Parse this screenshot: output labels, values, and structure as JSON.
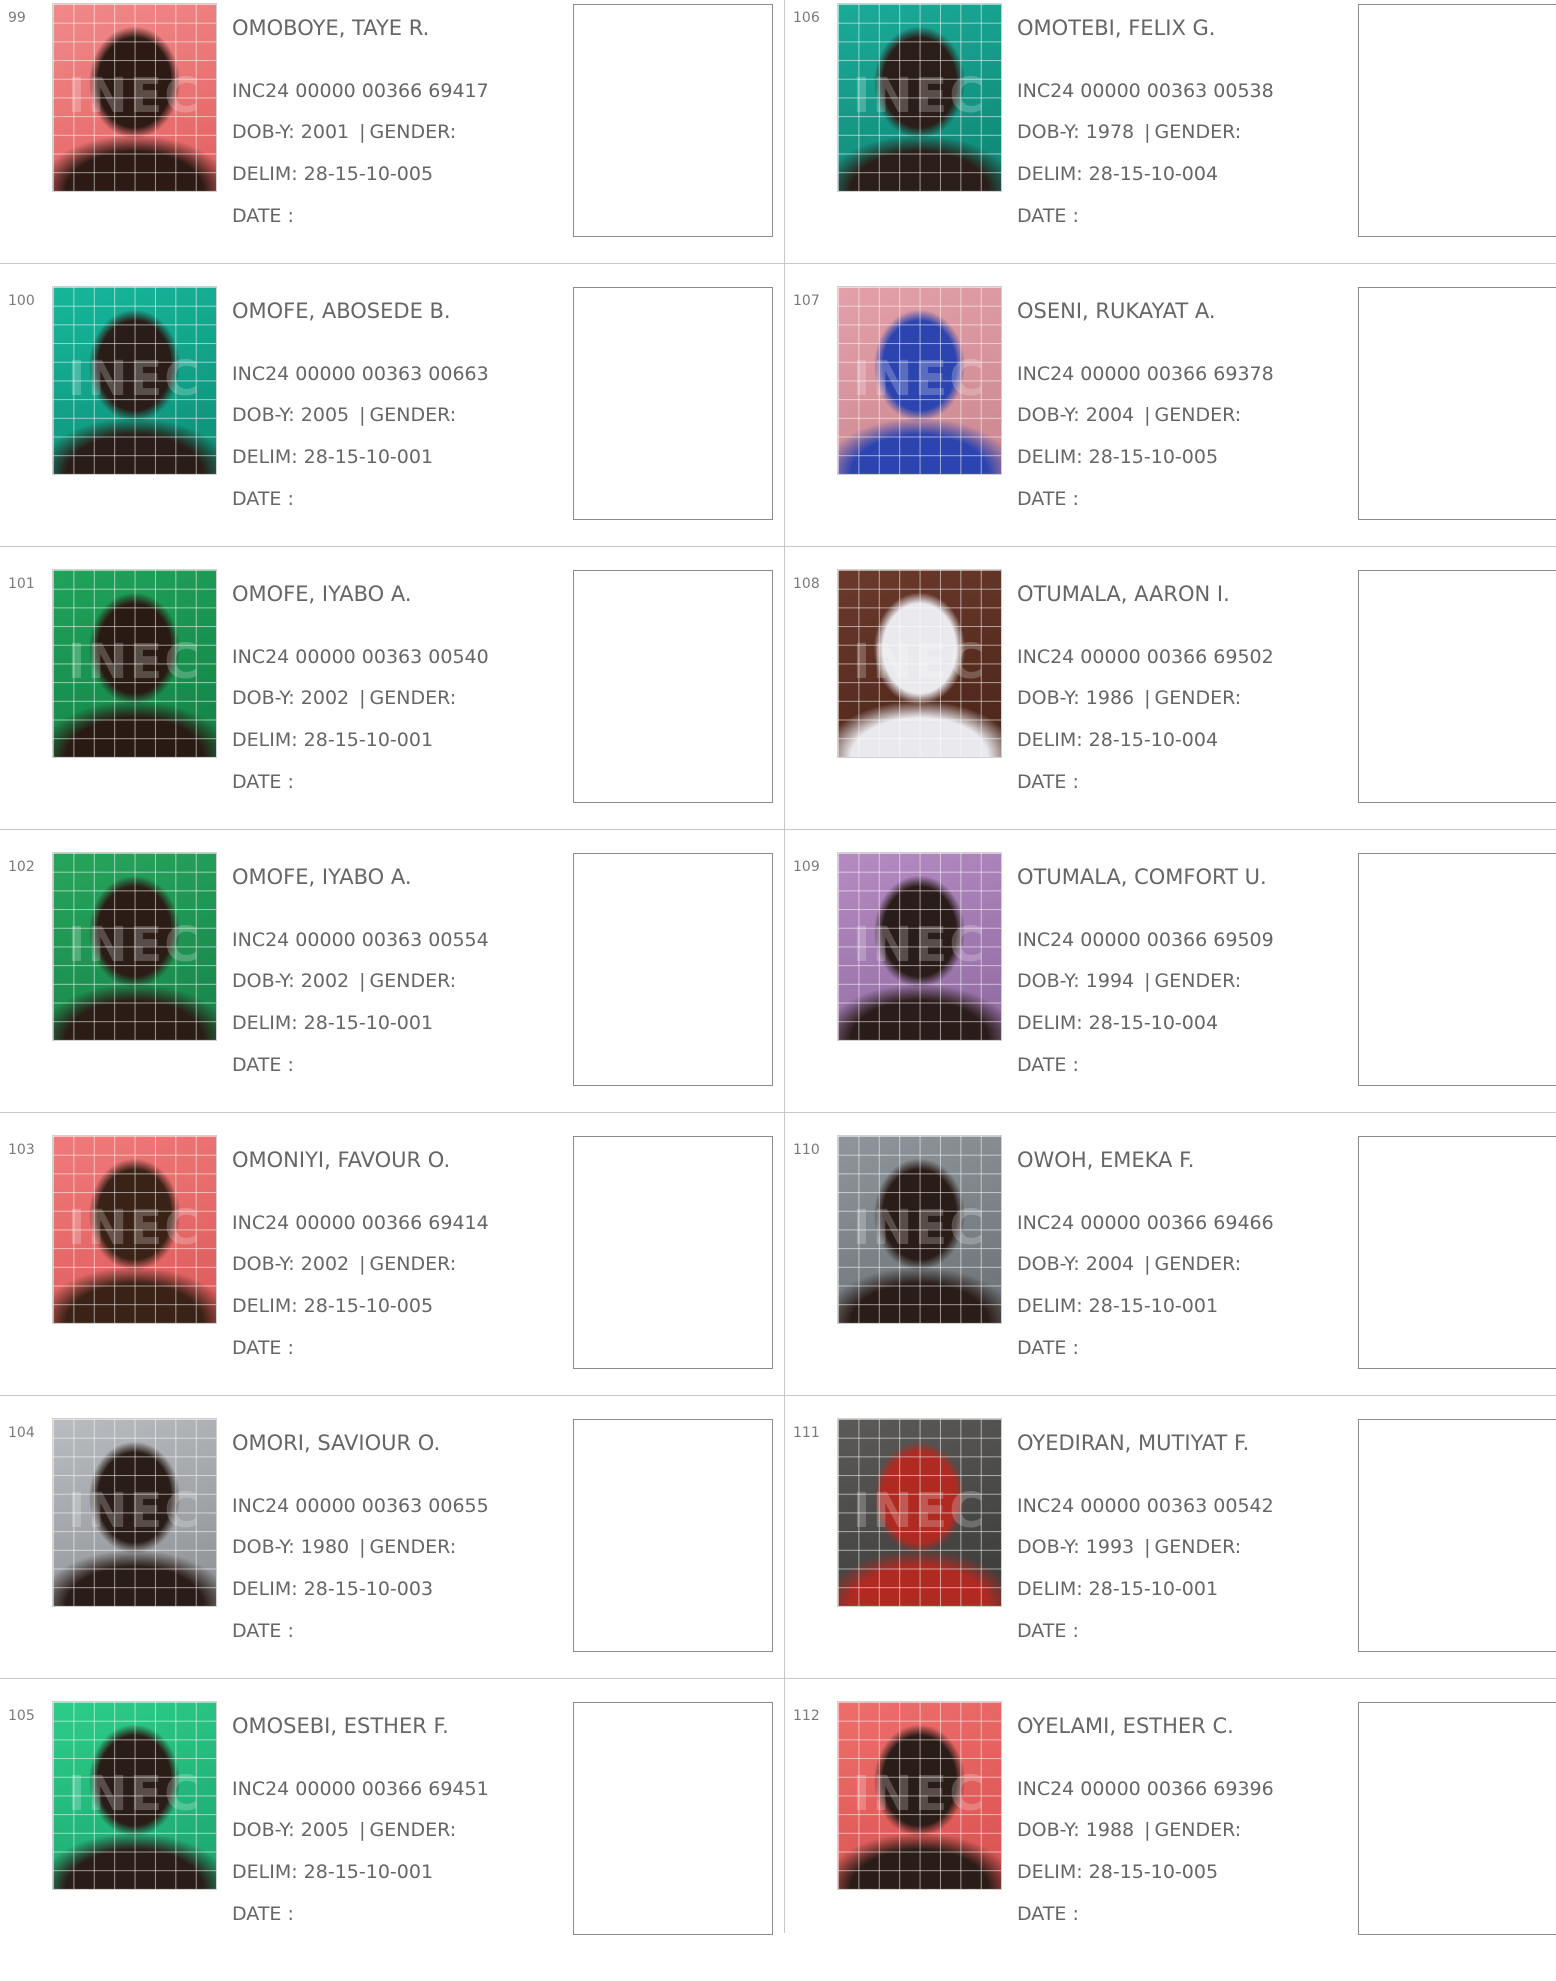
{
  "columns": [
    {
      "records": [
        {
          "number": "99",
          "name": "OMOBOYE, TAYE R.",
          "vin": "INC24 00000 00366 69417",
          "dob_label": "DOB-Y:",
          "dob": "2001",
          "gender_label": "GENDER:",
          "delim_label": "DELIM:",
          "delim": "28-15-10-005",
          "date_label": "DATE :",
          "photo_colors": [
            "#f08a8a",
            "#e45f5f",
            "#2d1a14"
          ]
        },
        {
          "number": "100",
          "name": "OMOFE, ABOSEDE B.",
          "vin": "INC24 00000 00363 00663",
          "dob_label": "DOB-Y:",
          "dob": "2005",
          "gender_label": "GENDER:",
          "delim_label": "DELIM:",
          "delim": "28-15-10-001",
          "date_label": "DATE :",
          "photo_colors": [
            "#16b79c",
            "#0d8e76",
            "#2a1d18"
          ]
        },
        {
          "number": "101",
          "name": "OMOFE, IYABO A.",
          "vin": "INC24 00000 00363 00540",
          "dob_label": "DOB-Y:",
          "dob": "2002",
          "gender_label": "GENDER:",
          "delim_label": "DELIM:",
          "delim": "28-15-10-001",
          "date_label": "DATE :",
          "photo_colors": [
            "#1fa35a",
            "#138245",
            "#2a1a14"
          ]
        },
        {
          "number": "102",
          "name": "OMOFE, IYABO A.",
          "vin": "INC24 00000 00363 00554",
          "dob_label": "DOB-Y:",
          "dob": "2002",
          "gender_label": "GENDER:",
          "delim_label": "DELIM:",
          "delim": "28-15-10-001",
          "date_label": "DATE :",
          "photo_colors": [
            "#26a55c",
            "#178448",
            "#2b1c16"
          ]
        },
        {
          "number": "103",
          "name": "OMONIYI, FAVOUR O.",
          "vin": "INC24 00000 00366 69414",
          "dob_label": "DOB-Y:",
          "dob": "2002",
          "gender_label": "GENDER:",
          "delim_label": "DELIM:",
          "delim": "28-15-10-005",
          "date_label": "DATE :",
          "photo_colors": [
            "#f07a7a",
            "#dd5959",
            "#3a2216"
          ]
        },
        {
          "number": "104",
          "name": "OMORI, SAVIOUR O.",
          "vin": "INC24 00000 00363 00655",
          "dob_label": "DOB-Y:",
          "dob": "1980",
          "gender_label": "GENDER:",
          "delim_label": "DELIM:",
          "delim": "28-15-10-003",
          "date_label": "DATE :",
          "photo_colors": [
            "#b9bcc0",
            "#8c8f93",
            "#2a1c17"
          ]
        },
        {
          "number": "105",
          "name": "OMOSEBI, ESTHER F.",
          "vin": "INC24 00000 00366 69451",
          "dob_label": "DOB-Y:",
          "dob": "2005",
          "gender_label": "GENDER:",
          "delim_label": "DELIM:",
          "delim": "28-15-10-001",
          "date_label": "DATE :",
          "photo_colors": [
            "#2ccd8a",
            "#1ba56e",
            "#2a1c16"
          ]
        }
      ]
    },
    {
      "records": [
        {
          "number": "106",
          "name": "OMOTEBI, FELIX G.",
          "vin": "INC24 00000 00363 00538",
          "dob_label": "DOB-Y:",
          "dob": "1978",
          "gender_label": "GENDER:",
          "delim_label": "DELIM:",
          "delim": "28-15-10-004",
          "date_label": "DATE :",
          "photo_colors": [
            "#1bab99",
            "#0f8574",
            "#2b1d18"
          ]
        },
        {
          "number": "107",
          "name": "OSENI, RUKAYAT A.",
          "vin": "INC24 00000 00366 69378",
          "dob_label": "DOB-Y:",
          "dob": "2004",
          "gender_label": "GENDER:",
          "delim_label": "DELIM:",
          "delim": "28-15-10-005",
          "date_label": "DATE :",
          "photo_colors": [
            "#e4a0a8",
            "#c98790",
            "#2c44b0"
          ]
        },
        {
          "number": "108",
          "name": "OTUMALA, AARON I.",
          "vin": "INC24 00000 00366 69502",
          "dob_label": "DOB-Y:",
          "dob": "1986",
          "gender_label": "GENDER:",
          "delim_label": "DELIM:",
          "delim": "28-15-10-004",
          "date_label": "DATE :",
          "photo_colors": [
            "#6b3a2c",
            "#4a2418",
            "#e9e9ee"
          ]
        },
        {
          "number": "109",
          "name": "OTUMALA, COMFORT U.",
          "vin": "INC24 00000 00366 69509",
          "dob_label": "DOB-Y:",
          "dob": "1994",
          "gender_label": "GENDER:",
          "delim_label": "DELIM:",
          "delim": "28-15-10-004",
          "date_label": "DATE :",
          "photo_colors": [
            "#b58bc2",
            "#8e6aa0",
            "#2a1c18"
          ]
        },
        {
          "number": "110",
          "name": "OWOH, EMEKA F.",
          "vin": "INC24 00000 00366 69466",
          "dob_label": "DOB-Y:",
          "dob": "2004",
          "gender_label": "GENDER:",
          "delim_label": "DELIM:",
          "delim": "28-15-10-001",
          "date_label": "DATE :",
          "photo_colors": [
            "#8e969b",
            "#6a7176",
            "#2a1c17"
          ]
        },
        {
          "number": "111",
          "name": "OYEDIRAN, MUTIYAT F.",
          "vin": "INC24 00000 00363 00542",
          "dob_label": "DOB-Y:",
          "dob": "1993",
          "gender_label": "GENDER:",
          "delim_label": "DELIM:",
          "delim": "28-15-10-001",
          "date_label": "DATE :",
          "photo_colors": [
            "#5b5a58",
            "#3a3a38",
            "#b02a22"
          ]
        },
        {
          "number": "112",
          "name": "OYELAMI, ESTHER C.",
          "vin": "INC24 00000 00366 69396",
          "dob_label": "DOB-Y:",
          "dob": "1988",
          "gender_label": "GENDER:",
          "delim_label": "DELIM:",
          "delim": "28-15-10-005",
          "date_label": "DATE :",
          "photo_colors": [
            "#ee6e6c",
            "#d8514f",
            "#2a1c16"
          ]
        }
      ]
    }
  ],
  "photo_watermark": "INEC"
}
